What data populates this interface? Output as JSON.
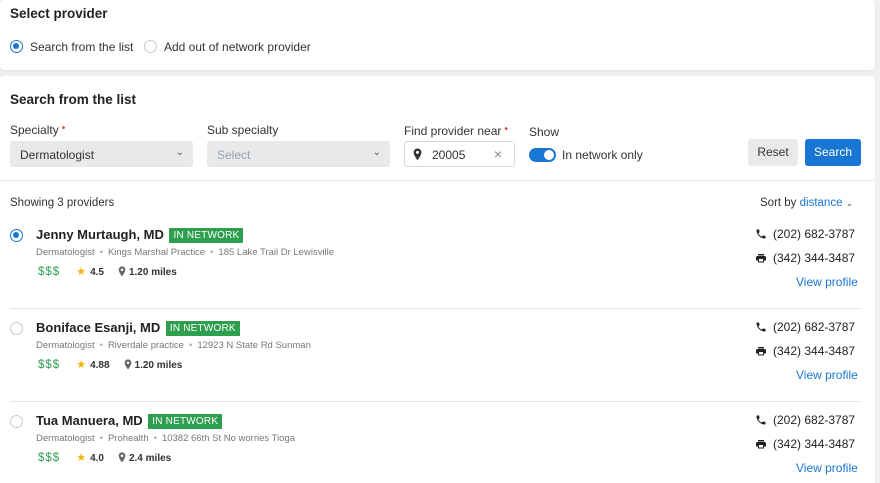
{
  "select_provider": {
    "title": "Select provider",
    "options": [
      {
        "label": "Search from the list",
        "selected": true
      },
      {
        "label": "Add out of network provider",
        "selected": false
      }
    ]
  },
  "search": {
    "title": "Search from the list",
    "specialty": {
      "label": "Specialty",
      "value": "Dermatologist"
    },
    "sub_specialty": {
      "label": "Sub specialty",
      "value": "Select"
    },
    "near": {
      "label": "Find provider near",
      "value": "20005"
    },
    "show": {
      "label": "Show",
      "toggle_label": "In network only",
      "on": true
    },
    "reset_label": "Reset",
    "search_label": "Search",
    "required_mark": "•"
  },
  "results": {
    "showing": "Showing 3 providers",
    "sort_prefix": "Sort by",
    "sort_value": "distance",
    "providers": [
      {
        "name": "Jenny Murtaugh, MD",
        "badge": "IN NETWORK",
        "specialty": "Dermatologist",
        "practice": "Kings Marshal Practice",
        "address": "185 Lake Trail Dr Lewisville",
        "cost": "$$$",
        "rating": "4.5",
        "distance": "1.20 miles",
        "phone": "(202) 682-3787",
        "fax": "(342) 344-3487",
        "profile_label": "View profile",
        "selected": true
      },
      {
        "name": "Boniface Esanji, MD",
        "badge": "IN NETWORK",
        "specialty": "Dermatologist",
        "practice": "Riverdale practice",
        "address": "12923 N State Rd Sunman",
        "cost": "$$$",
        "rating": "4.88",
        "distance": "1.20 miles",
        "phone": "(202) 682-3787",
        "fax": "(342) 344-3487",
        "profile_label": "View profile",
        "selected": false
      },
      {
        "name": "Tua Manuera, MD",
        "badge": "IN NETWORK",
        "specialty": "Dermatologist",
        "practice": "Prohealth",
        "address": "10382 66th St No worries Tioga",
        "cost": "$$$",
        "rating": "4.0",
        "distance": "2.4 miles",
        "phone": "(202) 682-3787",
        "fax": "(342) 344-3487",
        "profile_label": "View profile",
        "selected": false
      }
    ]
  },
  "colors": {
    "accent": "#1976d2",
    "badge": "#2e9e4f",
    "required": "#e53935",
    "star": "#f5b400"
  },
  "icons": [
    "radio-icon",
    "chevron-down-icon",
    "map-pin-icon",
    "clear-icon",
    "star-icon",
    "phone-icon",
    "fax-icon"
  ]
}
